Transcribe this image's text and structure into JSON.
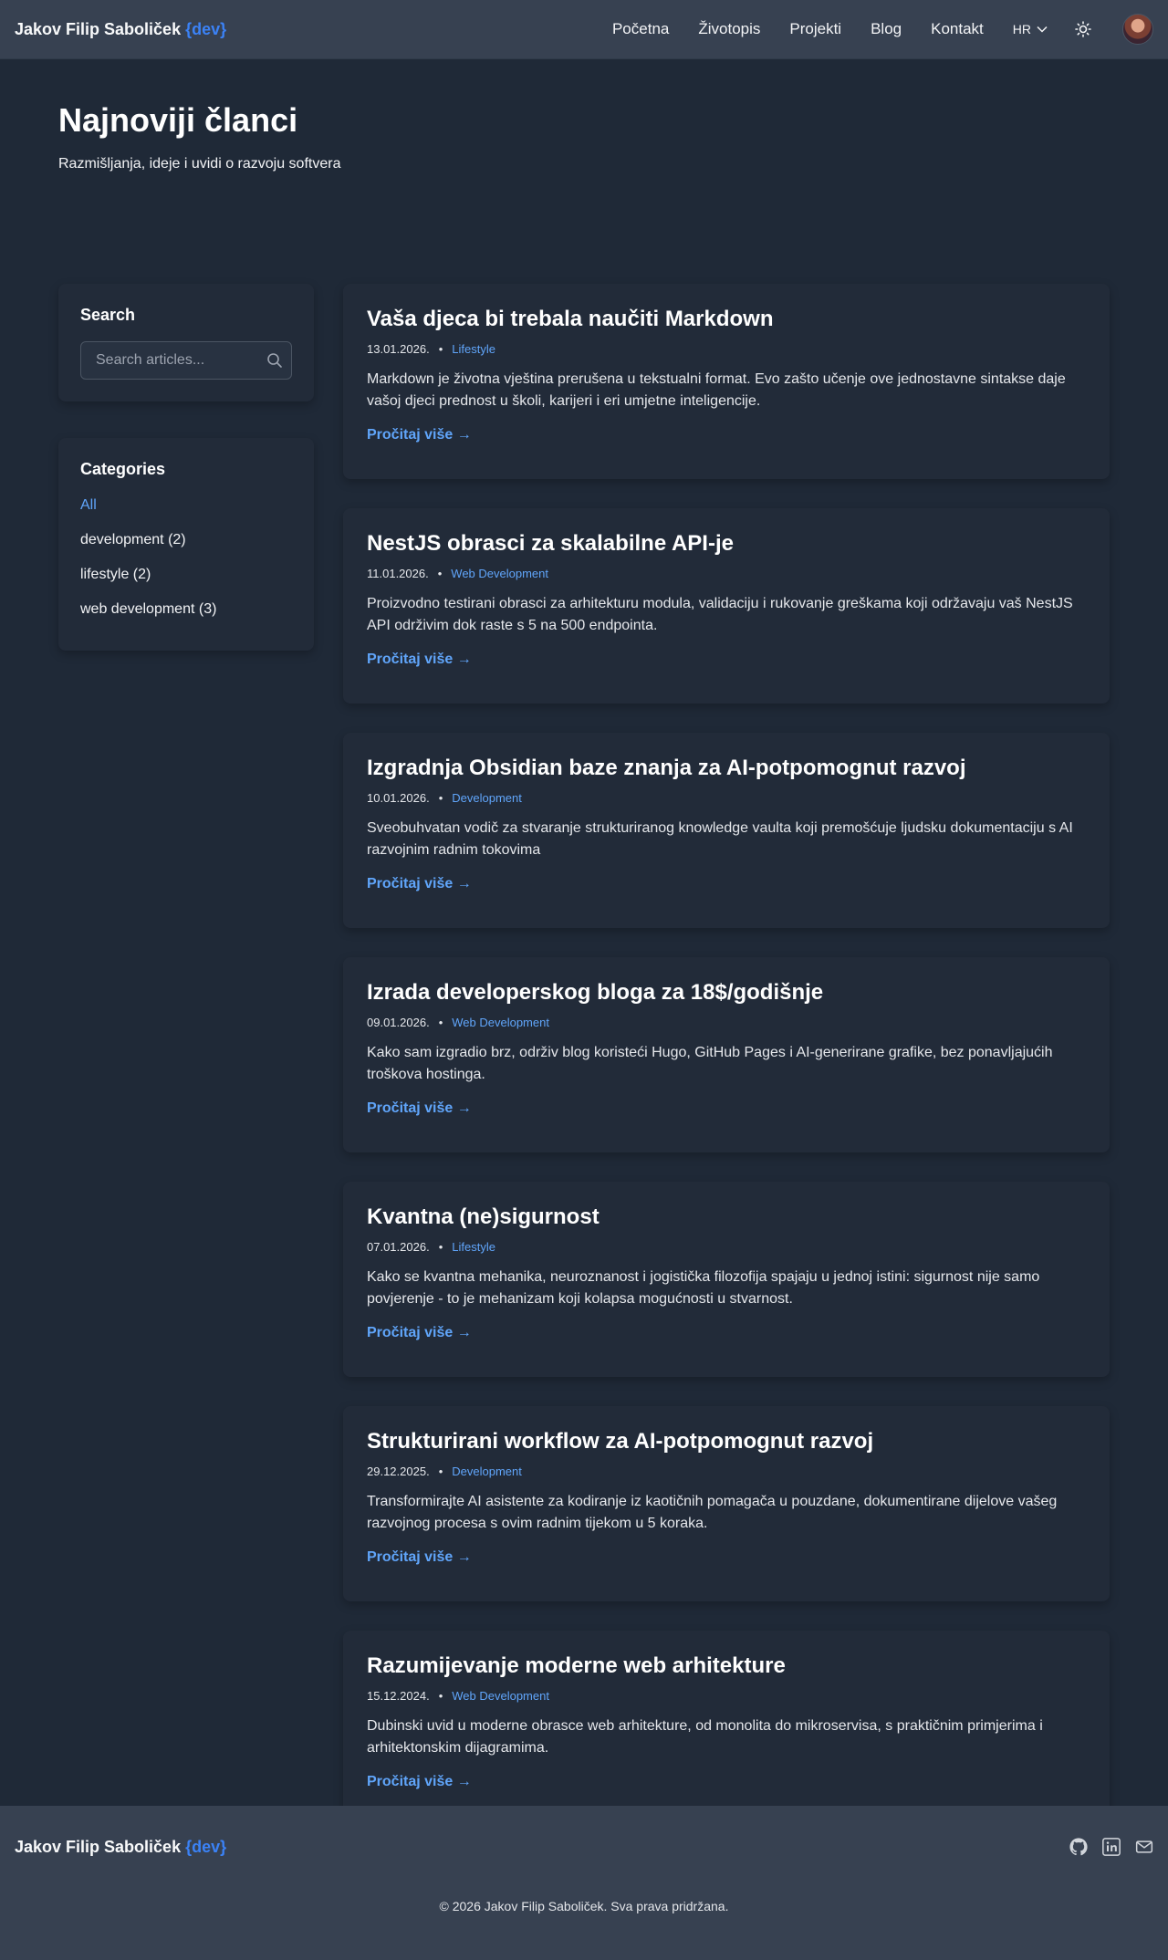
{
  "header": {
    "brand_name": "Jakov Filip Saboliček",
    "brand_tag": "{dev}",
    "nav": [
      {
        "label": "Početna"
      },
      {
        "label": "Životopis"
      },
      {
        "label": "Projekti"
      },
      {
        "label": "Blog"
      },
      {
        "label": "Kontakt"
      }
    ],
    "language": "HR",
    "theme_icon": "sun-icon",
    "avatar_icon": "avatar"
  },
  "hero": {
    "title": "Najnoviji članci",
    "subtitle": "Razmišljanja, ideje i uvidi o razvoju softvera"
  },
  "sidebar": {
    "search_title": "Search",
    "search_placeholder": "Search articles...",
    "search_value": "",
    "categories_title": "Categories",
    "categories": [
      {
        "label": "All",
        "active": true
      },
      {
        "label": "development (2)",
        "active": false
      },
      {
        "label": "lifestyle (2)",
        "active": false
      },
      {
        "label": "web development (3)",
        "active": false
      }
    ]
  },
  "articles": [
    {
      "title": "Vaša djeca bi trebala naučiti Markdown",
      "date": "13.01.2026.",
      "category": "Lifestyle",
      "excerpt": "Markdown je životna vještina prerušena u tekstualni format. Evo zašto učenje ove jednostavne sintakse daje vašoj djeci prednost u školi, karijeri i eri umjetne inteligencije.",
      "read_more": "Pročitaj više →"
    },
    {
      "title": "NestJS obrasci za skalabilne API-je",
      "date": "11.01.2026.",
      "category": "Web Development",
      "excerpt": "Proizvodno testirani obrasci za arhitekturu modula, validaciju i rukovanje greškama koji održavaju vaš NestJS API održivim dok raste s 5 na 500 endpointa.",
      "read_more": "Pročitaj više →"
    },
    {
      "title": "Izgradnja Obsidian baze znanja za AI-potpomognut razvoj",
      "date": "10.01.2026.",
      "category": "Development",
      "excerpt": "Sveobuhvatan vodič za stvaranje strukturiranog knowledge vaulta koji premošćuje ljudsku dokumentaciju s AI razvojnim radnim tokovima",
      "read_more": "Pročitaj više →"
    },
    {
      "title": "Izrada developerskog bloga za 18$/godišnje",
      "date": "09.01.2026.",
      "category": "Web Development",
      "excerpt": "Kako sam izgradio brz, održiv blog koristeći Hugo, GitHub Pages i AI-generirane grafike, bez ponavljajućih troškova hostinga.",
      "read_more": "Pročitaj više →"
    },
    {
      "title": "Kvantna (ne)sigurnost",
      "date": "07.01.2026.",
      "category": "Lifestyle",
      "excerpt": "Kako se kvantna mehanika, neuroznanost i jogistička filozofija spajaju u jednoj istini: sigurnost nije samo povjerenje - to je mehanizam koji kolapsa mogućnosti u stvarnost.",
      "read_more": "Pročitaj više →"
    },
    {
      "title": "Strukturirani workflow za AI-potpomognut razvoj",
      "date": "29.12.2025.",
      "category": "Development",
      "excerpt": "Transformirajte AI asistente za kodiranje iz kaotičnih pomagača u pouzdane, dokumentirane dijelove vašeg razvojnog procesa s ovim radnim tijekom u 5 koraka.",
      "read_more": "Pročitaj više →"
    },
    {
      "title": "Razumijevanje moderne web arhitekture",
      "date": "15.12.2024.",
      "category": "Web Development",
      "excerpt": "Dubinski uvid u moderne obrasce web arhitekture, od monolita do mikroservisa, s praktičnim primjerima i arhitektonskim dijagramima.",
      "read_more": "Pročitaj više →"
    }
  ],
  "footer": {
    "brand_name": "Jakov Filip Saboliček",
    "brand_tag": "{dev}",
    "icons": [
      "github-icon",
      "linkedin-icon",
      "mail-icon"
    ],
    "copyright": "© 2026 Jakov Filip Saboliček. Sva prava pridržana."
  },
  "colors": {
    "background": "#1f2937",
    "header": "#374151",
    "card": "#222b39",
    "accent": "#3b82f6",
    "link": "#60a5fa"
  }
}
